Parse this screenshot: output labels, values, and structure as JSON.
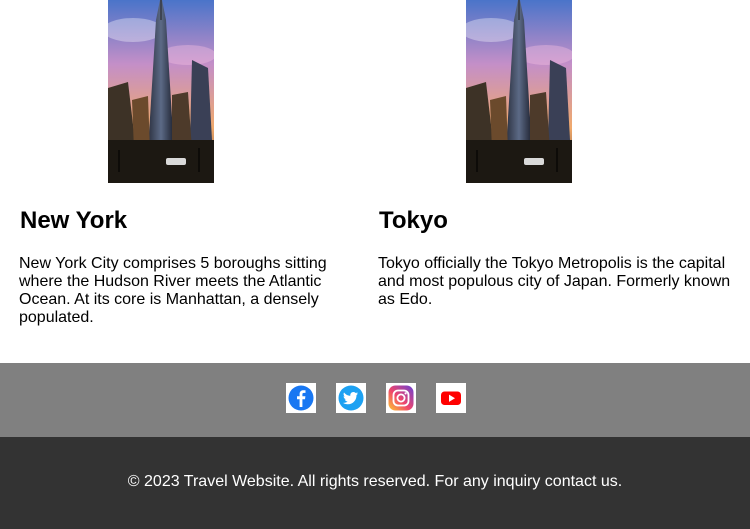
{
  "cities": [
    {
      "name": "New York",
      "description": "New York City comprises 5 boroughs sitting where the Hudson River meets the Atlantic Ocean. At its core is Manhattan, a densely populated."
    },
    {
      "name": "Tokyo",
      "description": "Tokyo officially the Tokyo Metropolis is the capital and most populous city of Japan. Formerly known as Edo."
    }
  ],
  "social": [
    {
      "name": "facebook",
      "icon": "facebook-icon",
      "color": "#1877f2"
    },
    {
      "name": "twitter",
      "icon": "twitter-icon",
      "color": "#1da1f2"
    },
    {
      "name": "instagram",
      "icon": "instagram-icon",
      "color": "#c13584"
    },
    {
      "name": "youtube",
      "icon": "youtube-icon",
      "color": "#ff0000"
    }
  ],
  "footer": {
    "text": "© 2023 Travel Website. All rights reserved. For any inquiry contact us."
  },
  "colors": {
    "social_bar_bg": "#808080",
    "footer_bg": "#333333"
  }
}
